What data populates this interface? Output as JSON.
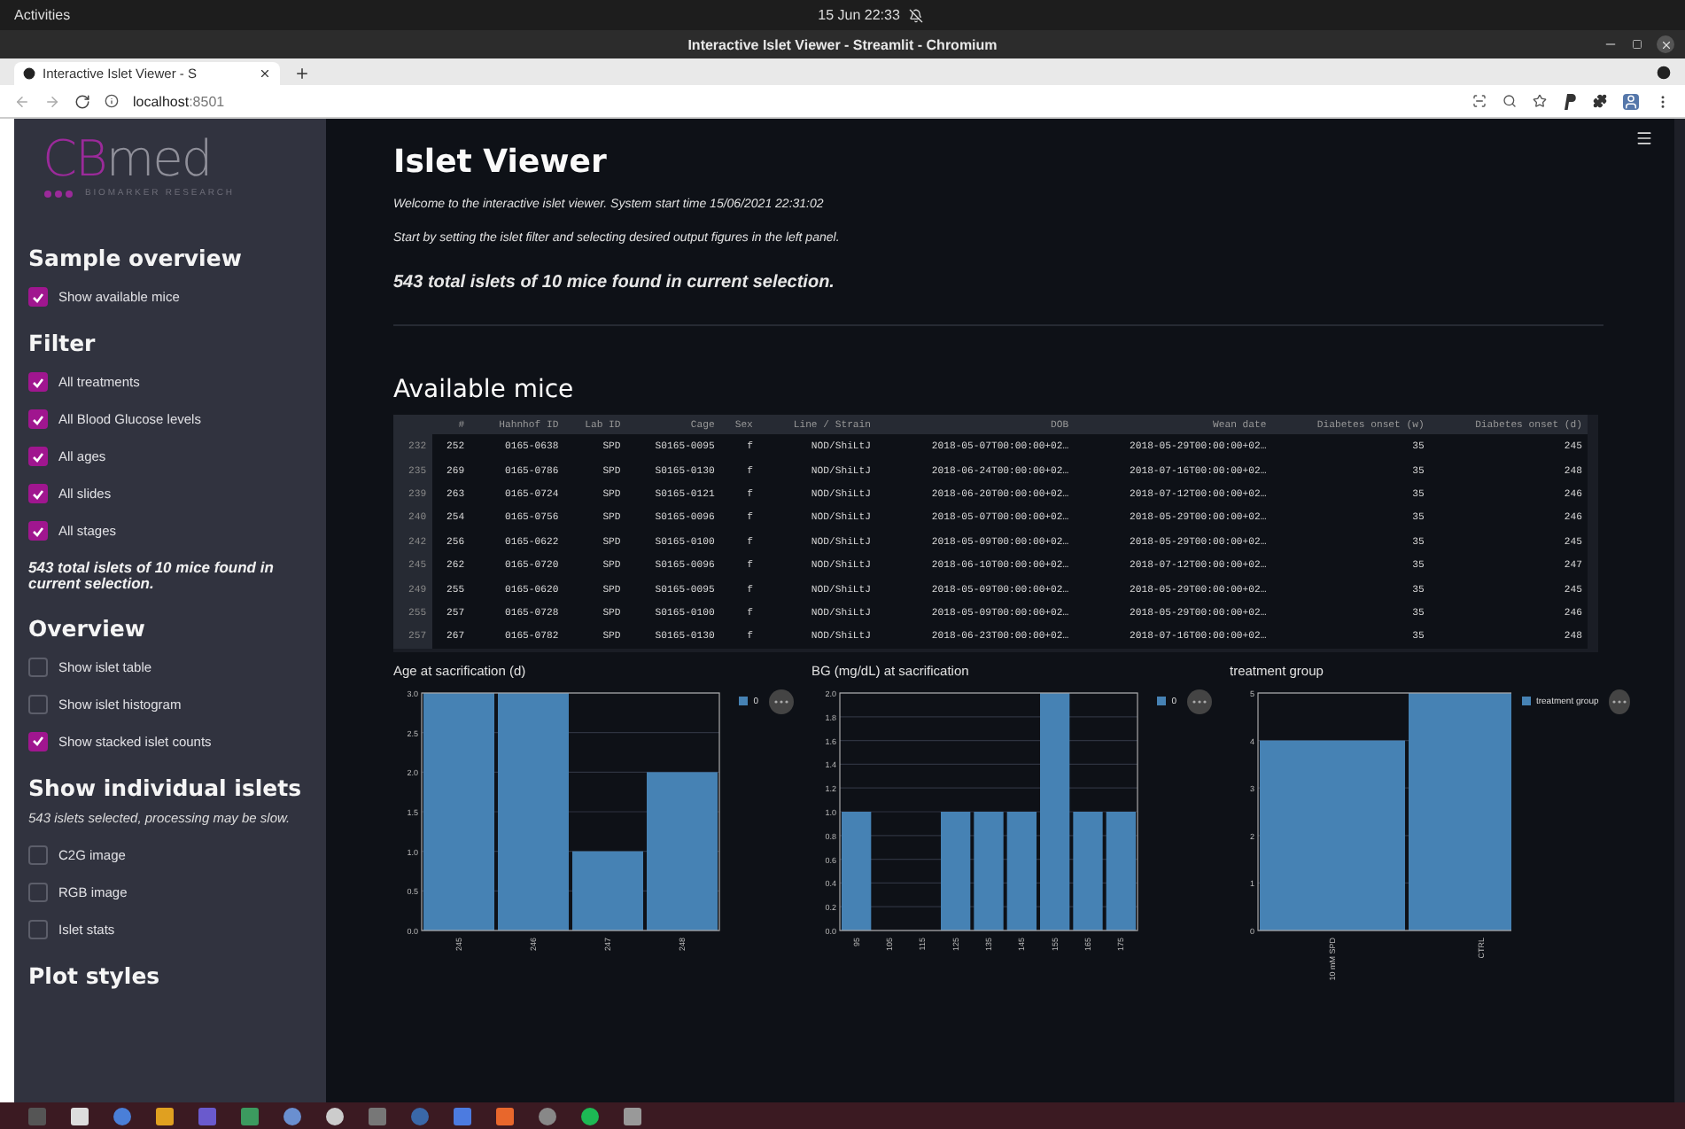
{
  "topbar": {
    "activities": "Activities",
    "clock": "15 Jun  22:33"
  },
  "window": {
    "title": "Interactive Islet Viewer - Streamlit - Chromium"
  },
  "browser": {
    "tabs": [
      {
        "label": "Interactive Islet Viewer - S",
        "selected": true
      }
    ],
    "address": "localhost",
    "port": ":8501"
  },
  "sidebar": {
    "logo": {
      "wordmark_1": "CB",
      "wordmark_2": "med",
      "tagline": "BIOMARKER RESEARCH"
    },
    "items": [
      {
        "kind": "heading",
        "text": "Sample overview"
      },
      {
        "kind": "checkbox",
        "label": "Show available mice",
        "checked": true
      },
      {
        "kind": "heading",
        "text": "Filter"
      },
      {
        "kind": "checkbox",
        "label": "All treatments",
        "checked": true
      },
      {
        "kind": "checkbox",
        "label": "All Blood Glucose levels",
        "checked": true
      },
      {
        "kind": "checkbox",
        "label": "All ages",
        "checked": true
      },
      {
        "kind": "checkbox",
        "label": "All slides",
        "checked": true
      },
      {
        "kind": "checkbox",
        "label": "All stages",
        "checked": true
      },
      {
        "kind": "note",
        "text": "543 total islets of 10 mice found in current selection."
      },
      {
        "kind": "heading",
        "text": "Overview"
      },
      {
        "kind": "checkbox",
        "label": "Show islet table",
        "checked": false
      },
      {
        "kind": "checkbox",
        "label": "Show islet histogram",
        "checked": false
      },
      {
        "kind": "checkbox",
        "label": "Show stacked islet counts",
        "checked": true
      },
      {
        "kind": "heading",
        "text": "Show individual islets"
      },
      {
        "kind": "hint",
        "text": "543 islets selected, processing may be slow."
      },
      {
        "kind": "checkbox",
        "label": "C2G image",
        "checked": false
      },
      {
        "kind": "checkbox",
        "label": "RGB image",
        "checked": false
      },
      {
        "kind": "checkbox",
        "label": "Islet stats",
        "checked": false
      },
      {
        "kind": "heading",
        "text": "Plot styles"
      }
    ]
  },
  "main": {
    "title": "Islet Viewer",
    "intro": "Welcome to the interactive islet viewer. System start time 15/06/2021 22:31:02",
    "instructions": "Start by setting the islet filter and selecting desired output figures in the left panel.",
    "summary": "543 total islets of 10 mice found in current selection.",
    "table_title": "Available mice"
  },
  "table": {
    "columns": [
      "",
      "#",
      "Hahnhof ID",
      "Lab ID",
      "Cage",
      "Sex",
      "Line / Strain",
      "DOB",
      "Wean date",
      "Diabetes onset (w)",
      "Diabetes onset (d)"
    ],
    "rows": [
      [
        "232",
        "252",
        "0165-0638",
        "SPD",
        "S0165-0095",
        "f",
        "NOD/ShiLtJ",
        "2018-05-07T00:00:00+02…",
        "2018-05-29T00:00:00+02…",
        "35",
        "245"
      ],
      [
        "235",
        "269",
        "0165-0786",
        "SPD",
        "S0165-0130",
        "f",
        "NOD/ShiLtJ",
        "2018-06-24T00:00:00+02…",
        "2018-07-16T00:00:00+02…",
        "35",
        "248"
      ],
      [
        "239",
        "263",
        "0165-0724",
        "SPD",
        "S0165-0121",
        "f",
        "NOD/ShiLtJ",
        "2018-06-20T00:00:00+02…",
        "2018-07-12T00:00:00+02…",
        "35",
        "246"
      ],
      [
        "240",
        "254",
        "0165-0756",
        "SPD",
        "S0165-0096",
        "f",
        "NOD/ShiLtJ",
        "2018-05-07T00:00:00+02…",
        "2018-05-29T00:00:00+02…",
        "35",
        "246"
      ],
      [
        "242",
        "256",
        "0165-0622",
        "SPD",
        "S0165-0100",
        "f",
        "NOD/ShiLtJ",
        "2018-05-09T00:00:00+02…",
        "2018-05-29T00:00:00+02…",
        "35",
        "245"
      ],
      [
        "245",
        "262",
        "0165-0720",
        "SPD",
        "S0165-0096",
        "f",
        "NOD/ShiLtJ",
        "2018-06-10T00:00:00+02…",
        "2018-07-12T00:00:00+02…",
        "35",
        "247"
      ],
      [
        "249",
        "255",
        "0165-0620",
        "SPD",
        "S0165-0095",
        "f",
        "NOD/ShiLtJ",
        "2018-05-09T00:00:00+02…",
        "2018-05-29T00:00:00+02…",
        "35",
        "245"
      ],
      [
        "255",
        "257",
        "0165-0728",
        "SPD",
        "S0165-0100",
        "f",
        "NOD/ShiLtJ",
        "2018-05-09T00:00:00+02…",
        "2018-05-29T00:00:00+02…",
        "35",
        "246"
      ],
      [
        "257",
        "267",
        "0165-0782",
        "SPD",
        "S0165-0130",
        "f",
        "NOD/ShiLtJ",
        "2018-06-23T00:00:00+02…",
        "2018-07-16T00:00:00+02…",
        "35",
        "248"
      ]
    ]
  },
  "charts": [
    {
      "chart_data": {
        "type": "bar",
        "title": "Age at sacrification (d)",
        "categories": [
          "245",
          "246",
          "247",
          "248"
        ],
        "series": [
          {
            "name": "0",
            "color": "#4682b4",
            "values": [
              3,
              3,
              1,
              2
            ]
          }
        ],
        "ylim": [
          0,
          3
        ],
        "grid": true,
        "yticks": [
          {
            "value": 0,
            "label": "0.0"
          },
          {
            "value": 0.5,
            "label": "0.5"
          },
          {
            "value": 1,
            "label": "1.0"
          },
          {
            "value": 1.5,
            "label": "1.5"
          },
          {
            "value": 2,
            "label": "2.0"
          },
          {
            "value": 2.5,
            "label": "2.5"
          },
          {
            "value": 3,
            "label": "3.0"
          }
        ]
      }
    },
    {
      "chart_data": {
        "type": "bar",
        "title": "BG (mg/dL) at sacrification",
        "categories": [
          "95",
          "105",
          "115",
          "125",
          "135",
          "145",
          "155",
          "165",
          "175"
        ],
        "series": [
          {
            "name": "0",
            "color": "#4682b4",
            "values": [
              1,
              0,
              0,
              1,
              1,
              1,
              2,
              1,
              1
            ]
          }
        ],
        "ylim": [
          0,
          2
        ],
        "grid": true,
        "yticks": [
          {
            "value": 0,
            "label": "0.0"
          },
          {
            "value": 0.2,
            "label": "0.2"
          },
          {
            "value": 0.4,
            "label": "0.4"
          },
          {
            "value": 0.6,
            "label": "0.6"
          },
          {
            "value": 0.8,
            "label": "0.8"
          },
          {
            "value": 1,
            "label": "1.0"
          },
          {
            "value": 1.2,
            "label": "1.2"
          },
          {
            "value": 1.4,
            "label": "1.4"
          },
          {
            "value": 1.6,
            "label": "1.6"
          },
          {
            "value": 1.8,
            "label": "1.8"
          },
          {
            "value": 2,
            "label": "2.0"
          }
        ]
      }
    },
    {
      "chart_data": {
        "type": "bar",
        "title": "treatment group",
        "categories": [
          "10 mM SPD",
          "CTRL"
        ],
        "series": [
          {
            "name": "treatment group",
            "color": "#4682b4",
            "values": [
              4,
              5
            ]
          }
        ],
        "ylim": [
          0,
          5
        ],
        "grid": true,
        "yticks": [
          0,
          1,
          2,
          3,
          4,
          5
        ]
      }
    }
  ]
}
